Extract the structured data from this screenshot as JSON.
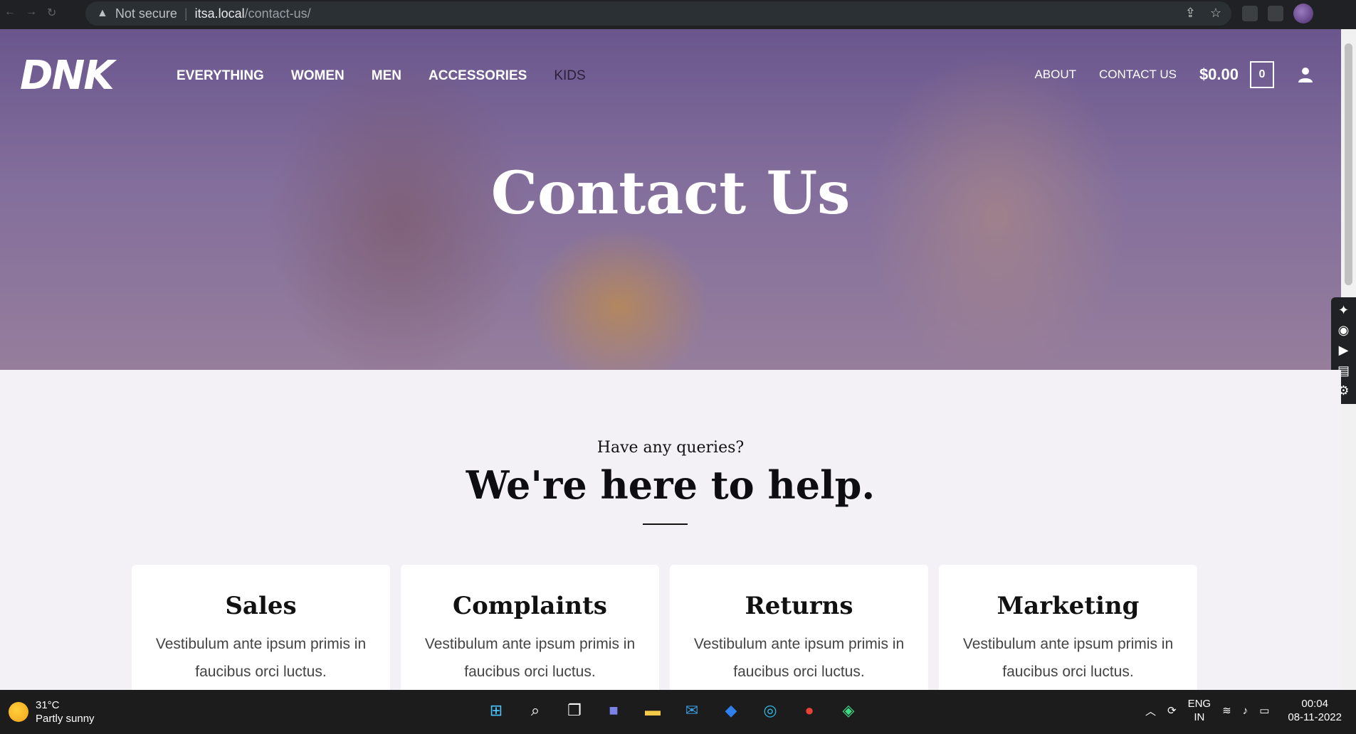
{
  "browser": {
    "security_label": "Not secure",
    "url_host": "itsa.local",
    "url_path": "/contact-us/"
  },
  "nav": {
    "logo": "DNK",
    "items": [
      "EVERYTHING",
      "WOMEN",
      "MEN",
      "ACCESSORIES",
      "KIDS"
    ],
    "about": "ABOUT",
    "contact": "CONTACT US",
    "cart_amount": "$0.00",
    "cart_count": "0"
  },
  "hero": {
    "title": "Contact Us"
  },
  "intro": {
    "kicker": "Have any queries?",
    "headline": "We're here to help."
  },
  "cards": [
    {
      "title": "Sales",
      "text": "Vestibulum ante ipsum primis in faucibus orci luctus."
    },
    {
      "title": "Complaints",
      "text": "Vestibulum ante ipsum primis in faucibus orci luctus."
    },
    {
      "title": "Returns",
      "text": "Vestibulum ante ipsum primis in faucibus orci luctus."
    },
    {
      "title": "Marketing",
      "text": "Vestibulum ante ipsum primis in faucibus orci luctus."
    }
  ],
  "taskbar": {
    "temperature": "31°C",
    "weather": "Partly sunny",
    "lang_top": "ENG",
    "lang_bottom": "IN",
    "time": "00:04",
    "date": "08-11-2022"
  }
}
